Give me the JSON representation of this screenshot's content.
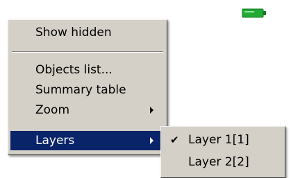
{
  "tray": {
    "icon": "battery-icon",
    "color": "#22aa33"
  },
  "context_menu": {
    "items": [
      {
        "label": "Show hidden"
      },
      {
        "label": "Objects list..."
      },
      {
        "label": "Summary table"
      },
      {
        "label": "Zoom",
        "has_submenu": true
      },
      {
        "label": "Layers",
        "has_submenu": true,
        "selected": true
      }
    ],
    "highlight_color": "#0a246a"
  },
  "layers_submenu": {
    "items": [
      {
        "label": "Layer 1[1]",
        "checked": true
      },
      {
        "label": "Layer 2[2]",
        "checked": false
      }
    ],
    "check_glyph": "✔"
  }
}
